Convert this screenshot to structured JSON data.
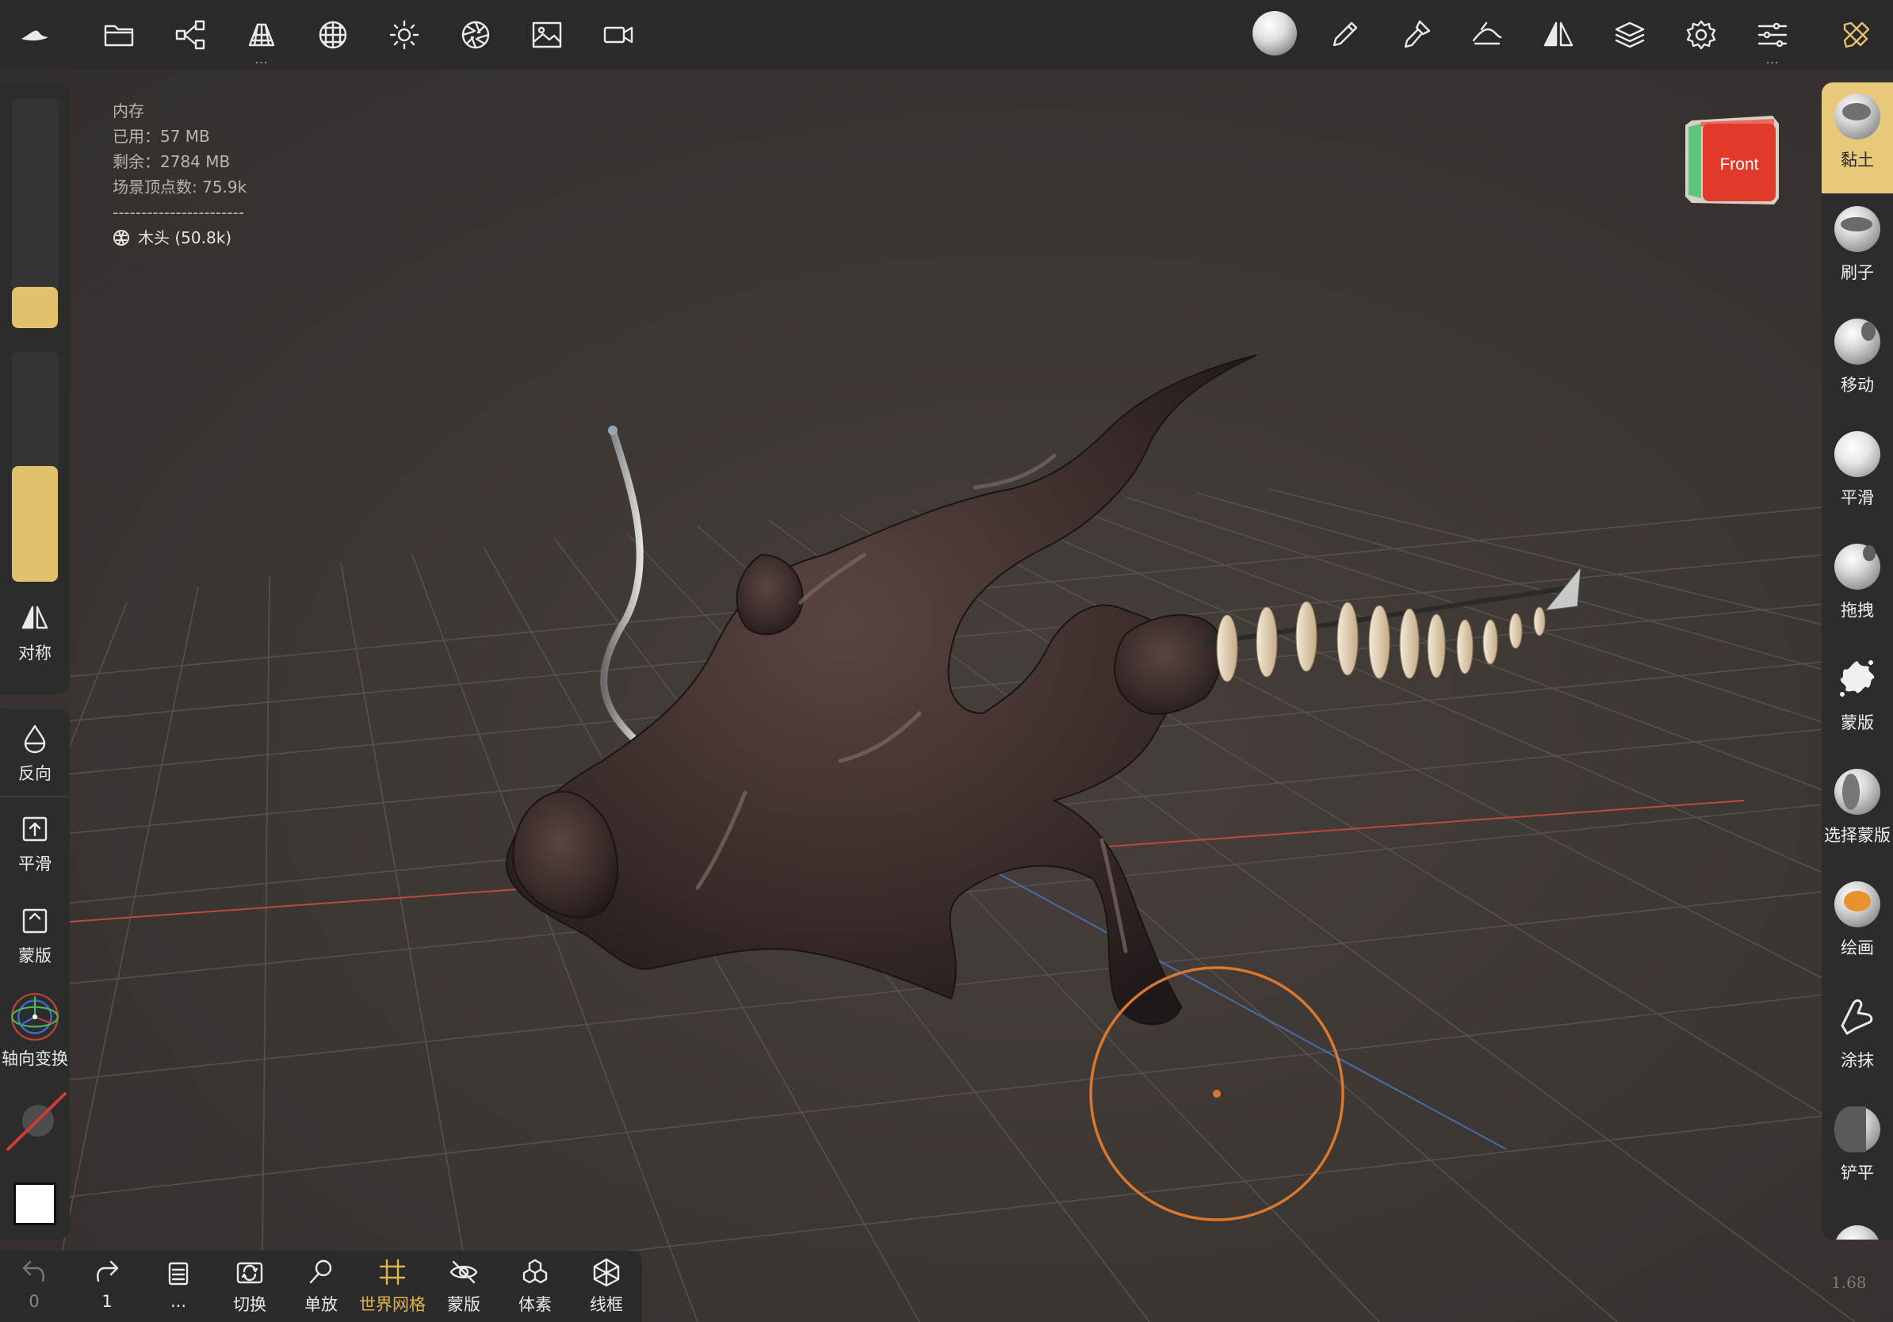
{
  "top_toolbar": {
    "icons": [
      "nomad-logo-icon",
      "folder-icon",
      "scene-graph-icon",
      "topology-icon",
      "multires-icon",
      "light-icon",
      "material-icon",
      "background-image-icon",
      "camera-icon",
      "matcap-icon",
      "stroke-icon",
      "paint-tool-icon",
      "shading-icon",
      "symmetry-icon",
      "layers-icon",
      "settings-icon",
      "sliders-icon",
      "tools-icon"
    ],
    "more_dots": "..."
  },
  "memory_info": {
    "title": "内存",
    "used": "已用：57 MB",
    "free": "剩余：2784 MB",
    "vertices": "场景顶点数: 75.9k",
    "separator": "-----------------------",
    "mesh": "木头 (50.8k)"
  },
  "nav_cube": {
    "face_label": "Front"
  },
  "left_panel": {
    "radius_level": 0.19,
    "intensity_level": 0.5,
    "symmetry_label": "对称",
    "invert_label": "反向",
    "smooth_label": "平滑",
    "mask_label": "蒙版",
    "gizmo_label": "轴向变换"
  },
  "right_tools": [
    {
      "label": "黏土",
      "active": true
    },
    {
      "label": "刷子",
      "active": false
    },
    {
      "label": "移动",
      "active": false
    },
    {
      "label": "平滑",
      "active": false
    },
    {
      "label": "拖拽",
      "active": false
    },
    {
      "label": "蒙版",
      "active": false
    },
    {
      "label": "选择蒙版",
      "active": false
    },
    {
      "label": "绘画",
      "active": false
    },
    {
      "label": "涂抹",
      "active": false
    },
    {
      "label": "铲平",
      "active": false
    }
  ],
  "bottom_bar": {
    "undo_count": "0",
    "redo_count": "1",
    "more_dots": "...",
    "switch_label": "切换",
    "solo_label": "单放",
    "grid_label": "世界网格",
    "mask_label": "蒙版",
    "voxel_label": "体素",
    "wireframe_label": "线框"
  },
  "colors": {
    "accent": "#e2c06c",
    "brush_ring": "#d9782e",
    "grid_x_axis": "#b94a3c",
    "grid_z_axis": "#4a6aa8",
    "background": "#3b3633"
  },
  "fps_readout": "1.68"
}
